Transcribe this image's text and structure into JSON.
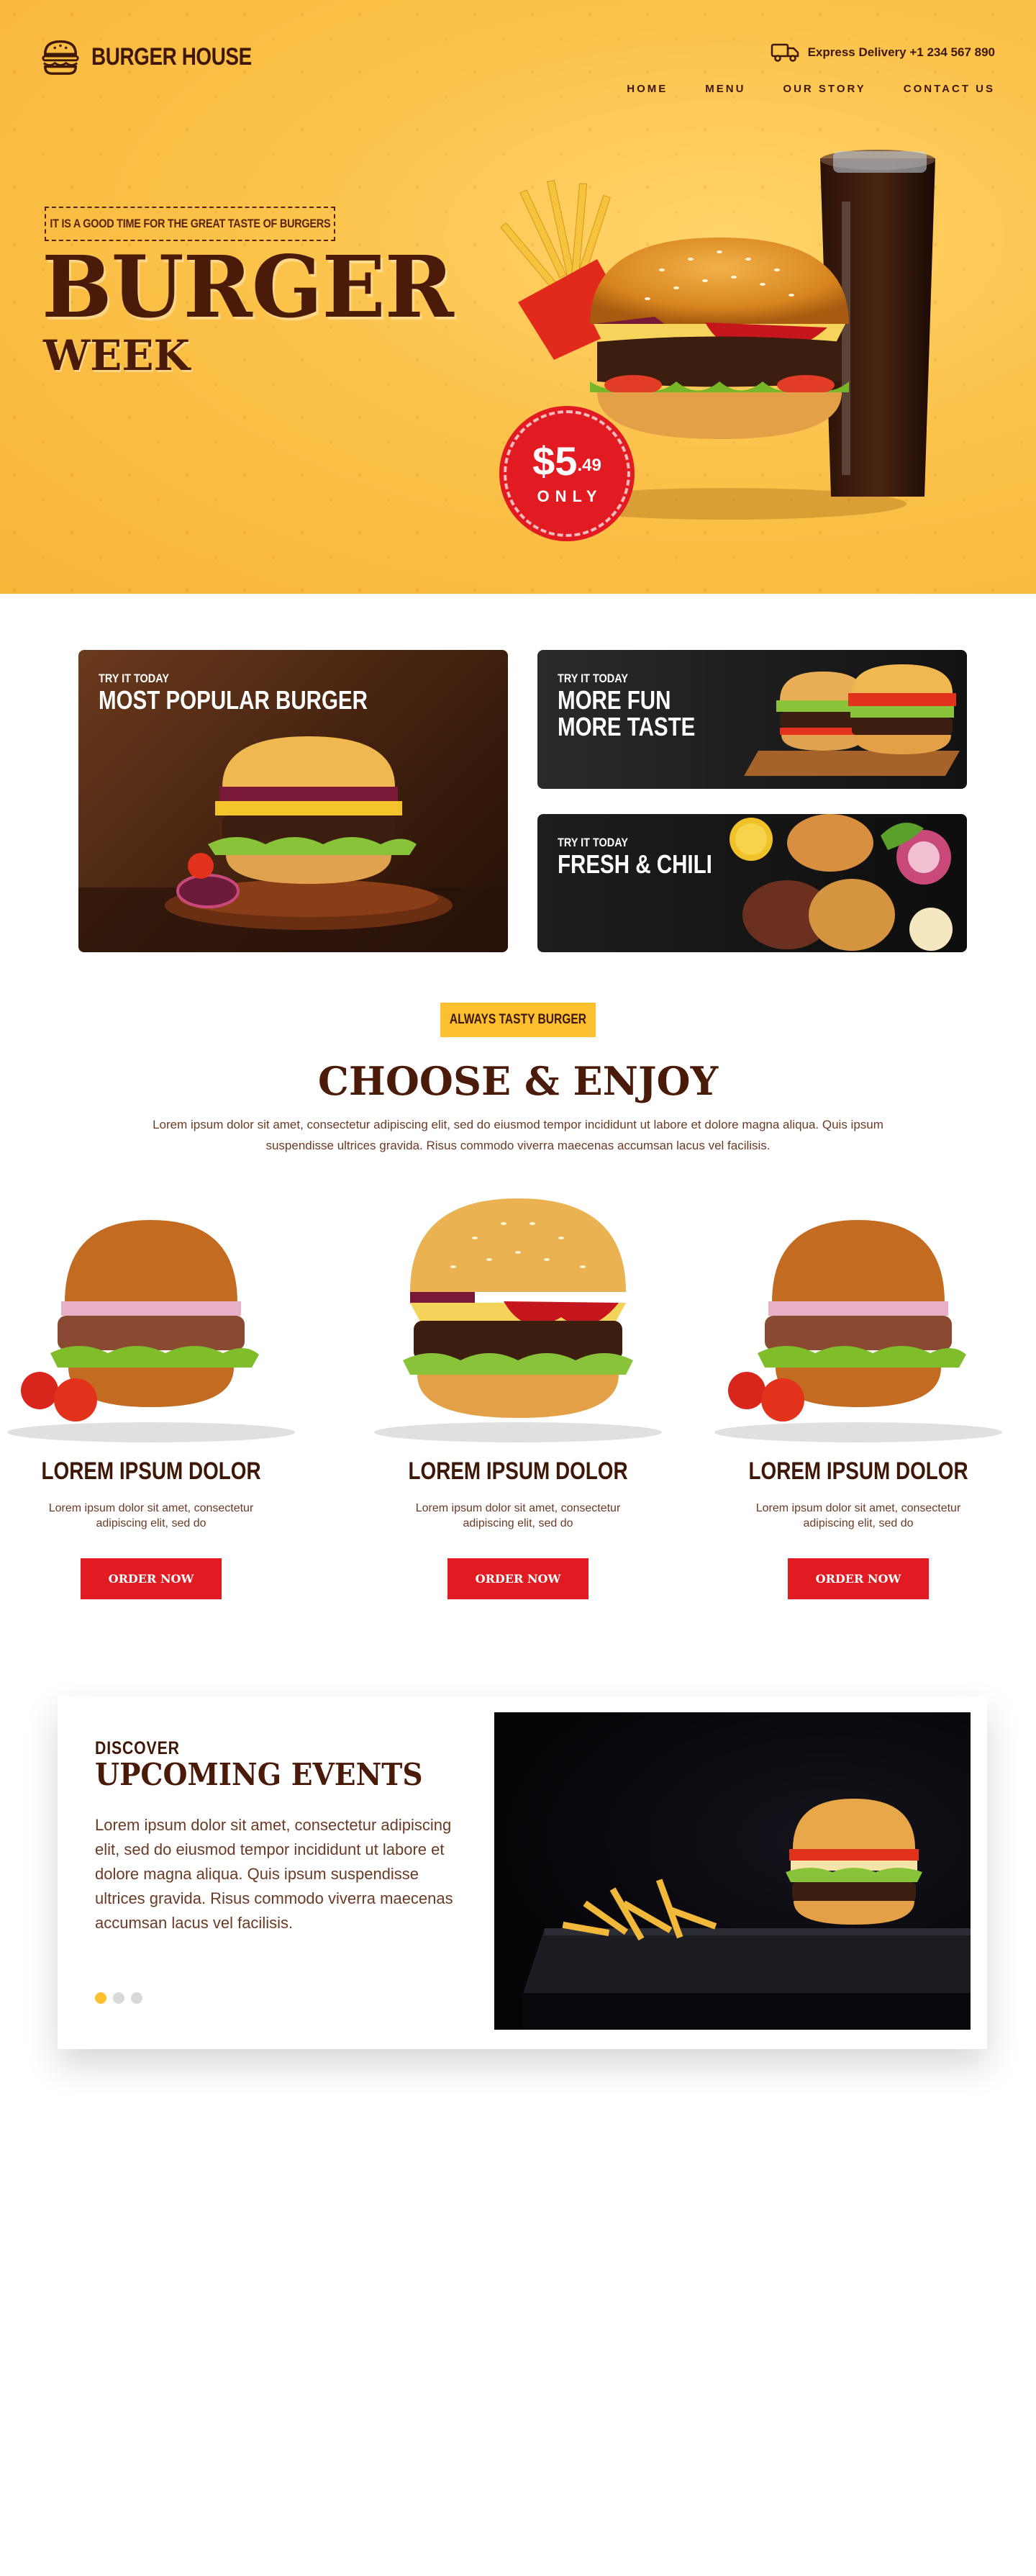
{
  "brand": {
    "name": "BURGER HOUSE"
  },
  "header": {
    "delivery_text": "Express Delivery +1 234 567 890",
    "nav": [
      "HOME",
      "MENU",
      "OUR STORY",
      "CONTACT US"
    ]
  },
  "hero": {
    "tagline": "IT IS A GOOD TIME FOR THE GREAT TASTE OF BURGERS",
    "title": "BURGER",
    "subtitle": "WEEK",
    "price_dollars": "$5",
    "price_cents": ".49",
    "price_note": "ONLY"
  },
  "promos": [
    {
      "small": "TRY IT TODAY",
      "big": "MOST POPULAR BURGER"
    },
    {
      "small": "TRY IT TODAY",
      "big": "MORE FUN\nMORE TASTE"
    },
    {
      "small": "TRY IT TODAY",
      "big": "FRESH & CHILI"
    }
  ],
  "choose": {
    "tag": "ALWAYS TASTY BURGER",
    "title": "CHOOSE & ENJOY",
    "description": "Lorem ipsum dolor sit amet, consectetur adipiscing elit, sed do eiusmod tempor incididunt ut labore et dolore magna aliqua. Quis ipsum suspendisse ultrices gravida. Risus commodo viverra maecenas accumsan lacus vel facilisis.",
    "products": [
      {
        "name": "LOREM IPSUM DOLOR",
        "desc": "Lorem ipsum dolor sit amet, consectetur adipiscing elit, sed do",
        "button": "ORDER NOW"
      },
      {
        "name": "LOREM IPSUM DOLOR",
        "desc": "Lorem ipsum dolor sit amet, consectetur adipiscing elit, sed do",
        "button": "ORDER NOW"
      },
      {
        "name": "LOREM IPSUM DOLOR",
        "desc": "Lorem ipsum dolor sit amet, consectetur adipiscing elit, sed do",
        "button": "ORDER NOW"
      }
    ]
  },
  "events": {
    "small": "DISCOVER",
    "title": "UPCOMING EVENTS",
    "body": "Lorem ipsum dolor sit amet, consectetur adipiscing elit, sed do eiusmod tempor incididunt ut labore et dolore magna aliqua. Quis ipsum suspendisse ultrices gravida. Risus commodo viverra maecenas accumsan lacus vel facilisis.",
    "slides": 3,
    "active_slide": 1
  },
  "colors": {
    "brand_yellow": "#fcc02e",
    "brand_brown": "#4a1b08",
    "accent_red": "#e21b23"
  }
}
